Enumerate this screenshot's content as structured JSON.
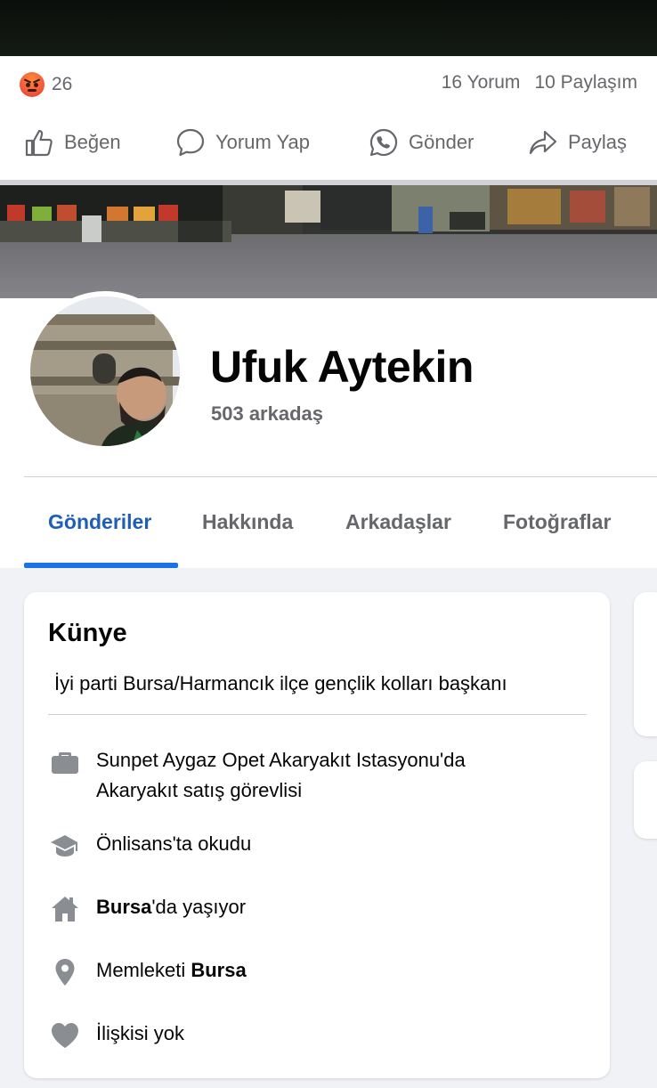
{
  "reactions": {
    "count": "26",
    "comments": "16 Yorum",
    "shares": "10 Paylaşım"
  },
  "actions": {
    "like": "Beğen",
    "comment": "Yorum Yap",
    "send": "Gönder",
    "share": "Paylaş"
  },
  "profile": {
    "name": "Ufuk Aytekin",
    "friends": "503 arkadaş"
  },
  "tabs": [
    {
      "label": "Gönderiler",
      "active": true
    },
    {
      "label": "Hakkında",
      "active": false
    },
    {
      "label": "Arkadaşlar",
      "active": false
    },
    {
      "label": "Fotoğraflar",
      "active": false
    }
  ],
  "intro": {
    "title": "Künye",
    "bio": "İyi parti Bursa/Harmancık ilçe gençlik kolları başkanı",
    "work_line1": "Sunpet Aygaz Opet Akaryakıt Istasyonu'da",
    "work_line2": "Akaryakıt satış görevlisi",
    "education": "Önlisans'ta okudu",
    "lives_city": "Bursa",
    "lives_suffix": "'da yaşıyor",
    "hometown_prefix": "Memleketi ",
    "hometown_city": "Bursa",
    "relationship": "İlişkisi yok"
  },
  "colors": {
    "accent": "#1b74e4",
    "active_tab_text": "#1e5fb5",
    "secondary_text": "#65676b",
    "icon_gray": "#8a8d91"
  },
  "icons": {
    "reaction": "angry-emoji-icon",
    "like": "thumbs-up-icon",
    "comment": "speech-bubble-icon",
    "send": "whatsapp-icon",
    "share": "share-arrow-icon",
    "work": "briefcase-icon",
    "education": "graduation-cap-icon",
    "home": "house-icon",
    "hometown": "location-pin-icon",
    "relationship": "heart-icon"
  }
}
